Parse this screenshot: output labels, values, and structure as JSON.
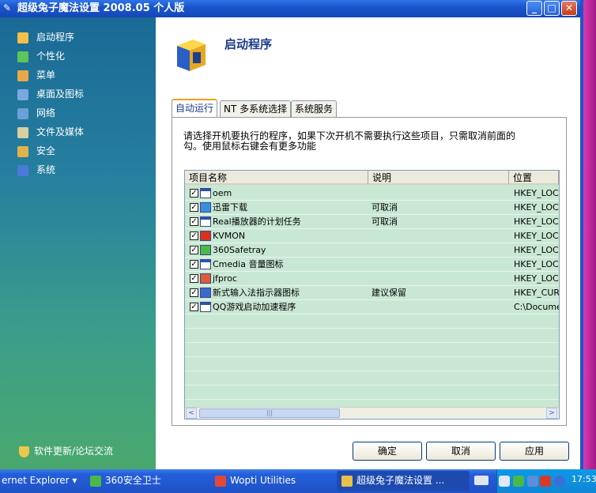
{
  "window": {
    "title": "超级兔子魔法设置 2008.05 个人版",
    "min": "_",
    "max": "□",
    "close": "✕"
  },
  "sidebar": {
    "items": [
      {
        "label": "启动程序",
        "icon": "startup-icon",
        "color": "#f2c14a"
      },
      {
        "label": "个性化",
        "icon": "personalize-icon",
        "color": "#5fc45a"
      },
      {
        "label": "菜单",
        "icon": "menu-icon",
        "color": "#e8a848"
      },
      {
        "label": "桌面及图标",
        "icon": "desktop-icon",
        "color": "#7aa8e0"
      },
      {
        "label": "网络",
        "icon": "network-icon",
        "color": "#6ba0d8"
      },
      {
        "label": "文件及媒体",
        "icon": "media-icon",
        "color": "#d8d0a0"
      },
      {
        "label": "安全",
        "icon": "security-icon",
        "color": "#e2b24a"
      },
      {
        "label": "系统",
        "icon": "system-icon",
        "color": "#4a7ad8"
      }
    ],
    "update_link": "软件更新/论坛交流"
  },
  "header": {
    "title": "启动程序"
  },
  "tabs": [
    {
      "label": "自动运行",
      "active": true
    },
    {
      "label": "NT 多系统选择",
      "active": false
    },
    {
      "label": "系统服务",
      "active": false
    }
  ],
  "description": "请选择开机要执行的程序，如果下次开机不需要执行这些项目，只需取消前面的勾。使用鼠标右键会有更多功能",
  "list": {
    "columns": [
      "项目名称",
      "说明",
      "位置"
    ],
    "rows": [
      {
        "name": "oem",
        "desc": "",
        "loc": "HKEY_LOCA",
        "checked": true,
        "icon": "window-app-icon"
      },
      {
        "name": "迅雷下载",
        "desc": "可取消",
        "loc": "HKEY_LOCA",
        "checked": true,
        "icon": "thunder-icon"
      },
      {
        "name": "Real播放器的计划任务",
        "desc": "可取消",
        "loc": "HKEY_LOCA",
        "checked": true,
        "icon": "window-app-icon"
      },
      {
        "name": "KVMON",
        "desc": "",
        "loc": "HKEY_LOCA",
        "checked": true,
        "icon": "kv-icon"
      },
      {
        "name": "360Safetray",
        "desc": "",
        "loc": "HKEY_LOCA",
        "checked": true,
        "icon": "shield-360-icon"
      },
      {
        "name": "Cmedia 音量图标",
        "desc": "",
        "loc": "HKEY_LOCA",
        "checked": true,
        "icon": "window-app-icon"
      },
      {
        "name": "jfproc",
        "desc": "",
        "loc": "HKEY_LOCA",
        "checked": true,
        "icon": "jf-icon"
      },
      {
        "name": "新式输入法指示器图标",
        "desc": "建议保留",
        "loc": "HKEY_CURR",
        "checked": true,
        "icon": "pen-icon"
      },
      {
        "name": "QQ游戏启动加速程序",
        "desc": "",
        "loc": "C:\\Documer",
        "checked": true,
        "icon": "window-app-icon"
      }
    ],
    "scroll_left": "<",
    "scroll_right": ">",
    "thumb_grip": "|||"
  },
  "buttons": {
    "ok": "确定",
    "cancel": "取消",
    "apply": "应用"
  },
  "taskbar": {
    "items": [
      {
        "label": "ernet Explorer",
        "arrow": "▾",
        "active": false
      },
      {
        "label": "360安全卫士",
        "active": false
      },
      {
        "label": "Wopti Utilities",
        "active": false
      },
      {
        "label": "超级兔子魔法设置 ...",
        "active": true
      }
    ],
    "clock": "17:53"
  }
}
